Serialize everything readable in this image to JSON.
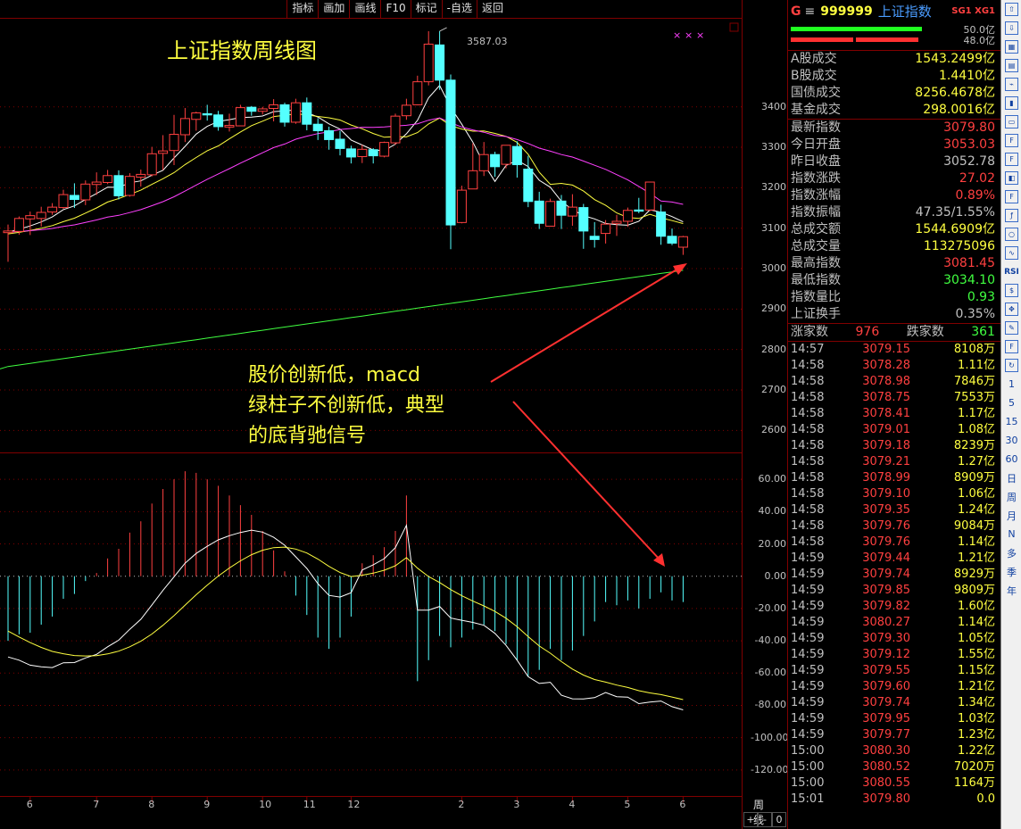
{
  "toolbar": {
    "buttons": [
      "指标",
      "画加",
      "画线",
      "F10",
      "标记",
      "-自选",
      "返回"
    ]
  },
  "chart": {
    "title": "上证指数周线图",
    "peak_label": "3587.03",
    "annotation": [
      "股价创新低，macd",
      "绿柱子不创新低，典型",
      "的底背驰信号"
    ],
    "period_label": "周线",
    "zoom": [
      "+",
      "-",
      "0"
    ],
    "price_axis": [
      "3400",
      "3300",
      "3200",
      "3100",
      "3000",
      "2900",
      "2800",
      "2700",
      "2600"
    ],
    "macd_axis": [
      "60.00",
      "40.00",
      "20.00",
      "0.00",
      "-20.00",
      "-40.00",
      "-60.00",
      "-80.00",
      "-100.00",
      "-120.00"
    ],
    "x_axis": [
      "6",
      "7",
      "8",
      "9",
      "10",
      "11",
      "12",
      "2",
      "3",
      "4",
      "5",
      "6"
    ],
    "colors": {
      "up": "#ff4040",
      "down": "#54ffff",
      "ma5": "#ffffff",
      "ma10": "#ffff40",
      "ma20": "#ff40ff",
      "ma60": "#40ff40",
      "grid": "#800000",
      "arrow": "#ff3030"
    }
  },
  "chart_data": {
    "type": "candlestick",
    "title": "上证指数周线图",
    "candles": [
      [
        3089,
        3093,
        3017,
        3109
      ],
      [
        3092,
        3124,
        3084,
        3129
      ],
      [
        3123,
        3131,
        3083,
        3141
      ],
      [
        3124,
        3139,
        3104,
        3153
      ],
      [
        3140,
        3152,
        3133,
        3162
      ],
      [
        3151,
        3183,
        3148,
        3195
      ],
      [
        3181,
        3171,
        3150,
        3211
      ],
      [
        3170,
        3209,
        3157,
        3218
      ],
      [
        3208,
        3214,
        3182,
        3238
      ],
      [
        3213,
        3230,
        3209,
        3244
      ],
      [
        3230,
        3180,
        3171,
        3243
      ],
      [
        3181,
        3228,
        3178,
        3236
      ],
      [
        3226,
        3233,
        3203,
        3245
      ],
      [
        3232,
        3284,
        3228,
        3301
      ],
      [
        3285,
        3291,
        3244,
        3330
      ],
      [
        3292,
        3332,
        3256,
        3380
      ],
      [
        3331,
        3371,
        3313,
        3397
      ],
      [
        3369,
        3385,
        3341,
        3388
      ],
      [
        3383,
        3380,
        3366,
        3405
      ],
      [
        3380,
        3351,
        3341,
        3390
      ],
      [
        3350,
        3354,
        3339,
        3383
      ],
      [
        3353,
        3398,
        3352,
        3405
      ],
      [
        3399,
        3389,
        3378,
        3402
      ],
      [
        3389,
        3395,
        3381,
        3400
      ],
      [
        3396,
        3405,
        3364,
        3419
      ],
      [
        3405,
        3362,
        3351,
        3410
      ],
      [
        3362,
        3410,
        3358,
        3420
      ],
      [
        3410,
        3357,
        3342,
        3423
      ],
      [
        3357,
        3341,
        3318,
        3372
      ],
      [
        3341,
        3319,
        3294,
        3351
      ],
      [
        3320,
        3297,
        3280,
        3341
      ],
      [
        3296,
        3276,
        3260,
        3304
      ],
      [
        3277,
        3295,
        3261,
        3306
      ],
      [
        3294,
        3279,
        3260,
        3298
      ],
      [
        3278,
        3312,
        3275,
        3314
      ],
      [
        3311,
        3377,
        3306,
        3383
      ],
      [
        3378,
        3404,
        3368,
        3420
      ],
      [
        3405,
        3462,
        3404,
        3477
      ],
      [
        3462,
        3555,
        3453,
        3587
      ],
      [
        3553,
        3466,
        3442,
        3587
      ],
      [
        3466,
        3108,
        3048,
        3480
      ],
      [
        3114,
        3194,
        3112,
        3205
      ],
      [
        3197,
        3242,
        3198,
        3310
      ],
      [
        3242,
        3282,
        3229,
        3313
      ],
      [
        3282,
        3252,
        3227,
        3289
      ],
      [
        3258,
        3305,
        3248,
        3305
      ],
      [
        3302,
        3257,
        3225,
        3315
      ],
      [
        3246,
        3166,
        3152,
        3279
      ],
      [
        3167,
        3112,
        3098,
        3190
      ],
      [
        3105,
        3166,
        3105,
        3173
      ],
      [
        3167,
        3132,
        3098,
        3182
      ],
      [
        3130,
        3152,
        3106,
        3184
      ],
      [
        3151,
        3093,
        3049,
        3160
      ],
      [
        3080,
        3072,
        3052,
        3115
      ],
      [
        3087,
        3110,
        3062,
        3120
      ],
      [
        3112,
        3117,
        3081,
        3133
      ],
      [
        3117,
        3144,
        3103,
        3151
      ],
      [
        3145,
        3142,
        3137,
        3175
      ],
      [
        3145,
        3214,
        3142,
        3215
      ],
      [
        3140,
        3080,
        3059,
        3158
      ],
      [
        3080,
        3063,
        3058,
        3099
      ],
      [
        3053,
        3079,
        3034,
        3081
      ]
    ],
    "macd_hist": [
      -40,
      -36,
      -35,
      -30,
      -25,
      -14,
      -11,
      -3,
      2,
      11,
      17,
      27,
      34,
      45,
      54,
      60,
      65,
      64,
      60,
      56,
      50,
      44,
      38,
      28,
      16,
      3,
      -12,
      -24,
      -38,
      -45,
      -38,
      -25,
      8,
      13,
      18,
      28,
      50,
      -65,
      -52,
      -37,
      -44,
      -38,
      -33,
      -30,
      -34,
      -42,
      -52,
      -62,
      -58,
      -45,
      -52,
      -46,
      -37,
      -28,
      -16,
      -18,
      -15,
      -20,
      -14,
      -10,
      -15,
      -16
    ],
    "series": [
      {
        "name": "DIF"
      },
      {
        "name": "DEA"
      }
    ],
    "ylim": [
      2550,
      3620
    ],
    "macd_ylim": [
      -135,
      75
    ]
  },
  "panel": {
    "header": {
      "icon": "G",
      "menu": "≡",
      "code": "999999",
      "name": "上证指数",
      "tag": "SG1 XG1"
    },
    "bars": [
      "50.0亿",
      "48.0亿"
    ],
    "turnover": [
      {
        "label": "A股成交",
        "value": "1543.2499亿"
      },
      {
        "label": "B股成交",
        "value": "1.4410亿"
      },
      {
        "label": "国债成交",
        "value": "8256.4678亿"
      },
      {
        "label": "基金成交",
        "value": "298.0016亿"
      }
    ],
    "quote": [
      {
        "label": "最新指数",
        "value": "3079.80",
        "color": "#ff4040"
      },
      {
        "label": "今日开盘",
        "value": "3053.03",
        "color": "#ff4040"
      },
      {
        "label": "昨日收盘",
        "value": "3052.78",
        "color": "#c0c0c0"
      },
      {
        "label": "指数涨跌",
        "value": "27.02",
        "color": "#ff4040"
      },
      {
        "label": "指数涨幅",
        "value": "0.89%",
        "color": "#ff4040"
      },
      {
        "label": "指数振幅",
        "value": "47.35/1.55%",
        "color": "#c0c0c0"
      },
      {
        "label": "总成交额",
        "value": "1544.6909亿",
        "color": "#ffff40"
      },
      {
        "label": "总成交量",
        "value": "113275096",
        "color": "#ffff40"
      },
      {
        "label": "最高指数",
        "value": "3081.45",
        "color": "#ff4040"
      },
      {
        "label": "最低指数",
        "value": "3034.10",
        "color": "#40ff40"
      },
      {
        "label": "指数量比",
        "value": "0.93",
        "color": "#40ff40"
      },
      {
        "label": "上证换手",
        "value": "0.35%",
        "color": "#c0c0c0"
      }
    ],
    "breadth": {
      "up_label": "涨家数",
      "up_value": "976",
      "down_label": "跌家数",
      "down_value": "361"
    },
    "trades": [
      [
        "14:57",
        "3079.15",
        "8108万"
      ],
      [
        "14:58",
        "3078.28",
        "1.11亿"
      ],
      [
        "14:58",
        "3078.98",
        "7846万"
      ],
      [
        "14:58",
        "3078.75",
        "7553万"
      ],
      [
        "14:58",
        "3078.41",
        "1.17亿"
      ],
      [
        "14:58",
        "3079.01",
        "1.08亿"
      ],
      [
        "14:58",
        "3079.18",
        "8239万"
      ],
      [
        "14:58",
        "3079.21",
        "1.27亿"
      ],
      [
        "14:58",
        "3078.99",
        "8909万"
      ],
      [
        "14:58",
        "3079.10",
        "1.06亿"
      ],
      [
        "14:58",
        "3079.35",
        "1.24亿"
      ],
      [
        "14:58",
        "3079.76",
        "9084万"
      ],
      [
        "14:58",
        "3079.76",
        "1.14亿"
      ],
      [
        "14:59",
        "3079.44",
        "1.21亿"
      ],
      [
        "14:59",
        "3079.74",
        "8929万"
      ],
      [
        "14:59",
        "3079.85",
        "9809万"
      ],
      [
        "14:59",
        "3079.82",
        "1.60亿"
      ],
      [
        "14:59",
        "3080.27",
        "1.14亿"
      ],
      [
        "14:59",
        "3079.30",
        "1.05亿"
      ],
      [
        "14:59",
        "3079.12",
        "1.55亿"
      ],
      [
        "14:59",
        "3079.55",
        "1.15亿"
      ],
      [
        "14:59",
        "3079.60",
        "1.21亿"
      ],
      [
        "14:59",
        "3079.74",
        "1.34亿"
      ],
      [
        "14:59",
        "3079.95",
        "1.03亿"
      ],
      [
        "14:59",
        "3079.77",
        "1.23亿"
      ],
      [
        "15:00",
        "3080.30",
        "1.22亿"
      ],
      [
        "15:00",
        "3080.52",
        "7020万"
      ],
      [
        "15:00",
        "3080.55",
        "1164万"
      ],
      [
        "15:01",
        "3079.80",
        "0.0"
      ]
    ]
  },
  "sidebar": {
    "icons": [
      "up-arrow-icon",
      "down-arrow-icon",
      "table-icon",
      "grid-icon",
      "line-chart-icon",
      "candle-icon",
      "news-icon",
      "f10-icon",
      "f-icon",
      "info-icon",
      "fz-icon",
      "fn-icon",
      "circle-icon",
      "wave-icon",
      "rsi-icon",
      "money-icon",
      "move-icon",
      "pencil-icon",
      "f5-icon",
      "refresh-icon"
    ],
    "periods": [
      "1",
      "5",
      "15",
      "30",
      "60",
      "日",
      "周",
      "月",
      "N",
      "多",
      "季",
      "年"
    ],
    "rsi_label": "RSI"
  }
}
